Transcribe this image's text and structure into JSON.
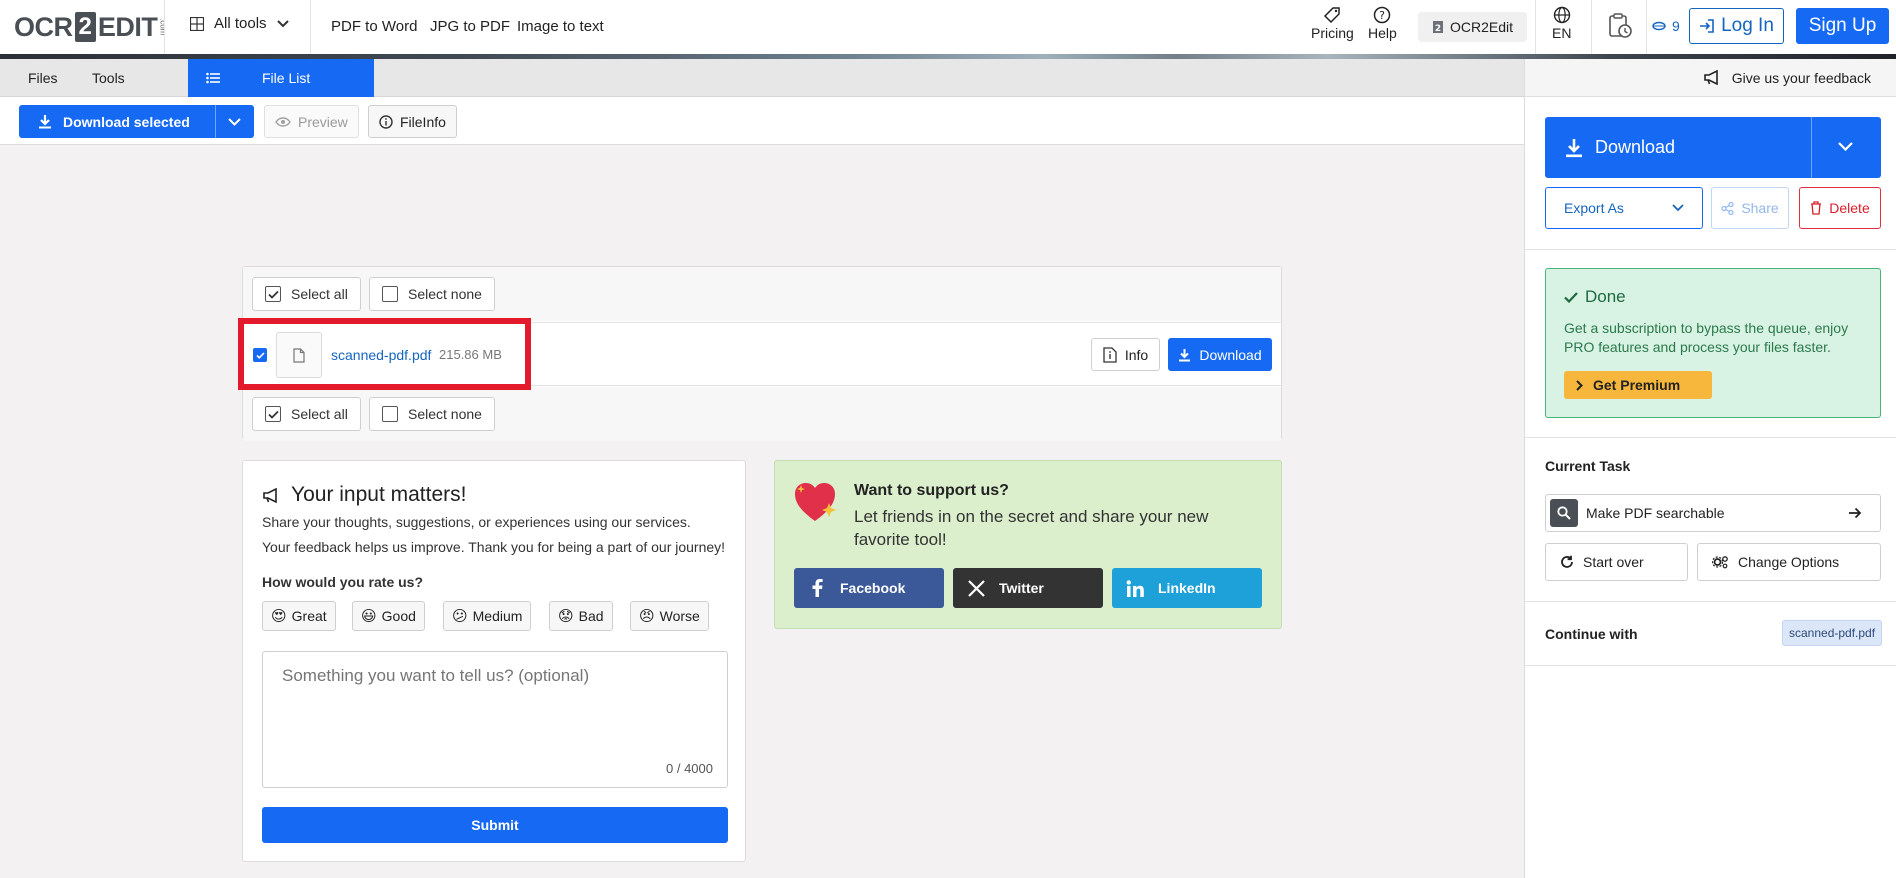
{
  "header": {
    "logo": {
      "left": "OCR",
      "digit": "2",
      "right": "EDIT",
      "suffix": ".com"
    },
    "all_tools_label": "All tools",
    "quick_links": [
      "PDF to Word",
      "JPG to PDF",
      "Image to text"
    ],
    "pricing_label": "Pricing",
    "help_label": "Help",
    "brand_label": "OCR2Edit",
    "language": "EN",
    "credits": "9",
    "login_label": "Log In",
    "signup_label": "Sign Up"
  },
  "tabs": {
    "files": "Files",
    "tools": "Tools",
    "file_list": "File List"
  },
  "toolbar": {
    "download_selected": "Download selected",
    "preview": "Preview",
    "fileinfo": "FileInfo"
  },
  "file_list": {
    "select_all": "Select all",
    "select_none": "Select none",
    "files": [
      {
        "name": "scanned-pdf.pdf",
        "size": "215.86 MB",
        "checked": true,
        "info_label": "Info",
        "download_label": "Download"
      }
    ]
  },
  "feedback": {
    "title": "Your input matters!",
    "line1": "Share your thoughts, suggestions, or experiences using our services.",
    "line2": "Your feedback helps us improve. Thank you for being a part of our journey!",
    "question": "How would you rate us?",
    "ratings": [
      {
        "emoji": "😍",
        "label": "Great"
      },
      {
        "emoji": "😃",
        "label": "Good"
      },
      {
        "emoji": "😕",
        "label": "Medium"
      },
      {
        "emoji": "😟",
        "label": "Bad"
      },
      {
        "emoji": "😠",
        "label": "Worse"
      }
    ],
    "placeholder": "Something you want to tell us? (optional)",
    "counter": "0 / 4000",
    "submit": "Submit"
  },
  "support": {
    "title": "Want to support us?",
    "text": "Let friends in on the secret and share your new favorite tool!",
    "buttons": [
      {
        "label": "Facebook",
        "color": "#3b5998"
      },
      {
        "label": "Twitter",
        "color": "#333333"
      },
      {
        "label": "LinkedIn",
        "color": "#1ea0d8"
      }
    ]
  },
  "sidebar": {
    "feedback_link": "Give us your feedback",
    "download": "Download",
    "export_as": "Export As",
    "share": "Share",
    "delete": "Delete",
    "done_title": "Done",
    "done_text": "Get a subscription to bypass the queue, enjoy PRO features and process your files faster.",
    "premium": "Get Premium",
    "current_task_label": "Current Task",
    "current_task": "Make PDF searchable",
    "start_over": "Start over",
    "change_options": "Change Options",
    "continue_with": "Continue with",
    "continue_file": "scanned-pdf.pdf"
  },
  "colors": {
    "accent": "#1669f2",
    "highlight": "#e21a2c",
    "done_bg": "#d8f2e4",
    "support_bg": "#dcefcd",
    "premium": "#f6b73c"
  }
}
